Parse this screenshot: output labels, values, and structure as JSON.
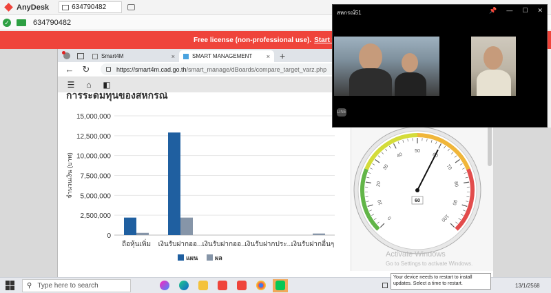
{
  "anydesk": {
    "app_name": "AnyDesk",
    "tab_id": "634790482",
    "address_id": "634790482",
    "banner_text": "Free license (non-professional use).",
    "banner_link": "Start trial licens"
  },
  "browser": {
    "tabs": [
      {
        "label": "Smart4M",
        "close": "×"
      },
      {
        "label": "SMART MANAGEMENT",
        "close": "×"
      }
    ],
    "new_tab": "+",
    "url_host": "https://smart4m.cad.go.th",
    "url_path": "/smart_manage/dBoards/compare_target_varz.php"
  },
  "page": {
    "heading": "การระดมทุนของสหกรณ์"
  },
  "chart_data": {
    "type": "bar",
    "categories": [
      "ถือหุ้นเพิ่ม",
      "เงินรับฝากออ...",
      "เงินรับฝากออ...",
      "เงินรับฝากประ...",
      "เงินรับฝากอื่นๆ"
    ],
    "series": [
      {
        "name": "แผน",
        "values": [
          2200000,
          12900000,
          0,
          0,
          0
        ],
        "color": "#1f5fa0"
      },
      {
        "name": "ผล",
        "values": [
          280000,
          2200000,
          0,
          0,
          200000
        ],
        "color": "#8695a8"
      }
    ],
    "ylabel": "จำนวนเงิน (บาท)",
    "ylim": [
      0,
      15000000
    ],
    "yticks": [
      "0",
      "2,500,000",
      "5,000,000",
      "7,500,000",
      "10,000,000",
      "12,500,000",
      "15,000,000"
    ],
    "legend_position": "bottom",
    "grid": true
  },
  "gauge": {
    "value": 60,
    "value_label": "60",
    "ticks": [
      "0",
      "10",
      "20",
      "30",
      "40",
      "50",
      "60",
      "70",
      "80",
      "90",
      "100"
    ]
  },
  "activate": {
    "line1": "Activate Windows",
    "line2": "Go to Settings to activate Windows."
  },
  "video_call": {
    "title": "สหกรณ์51",
    "line_badge": "LINE"
  },
  "taskbar": {
    "search_placeholder": "Type here to search",
    "date": "13/1/2568"
  },
  "notification": {
    "text": "Your device needs to restart to install updates. Select a time to restart."
  }
}
